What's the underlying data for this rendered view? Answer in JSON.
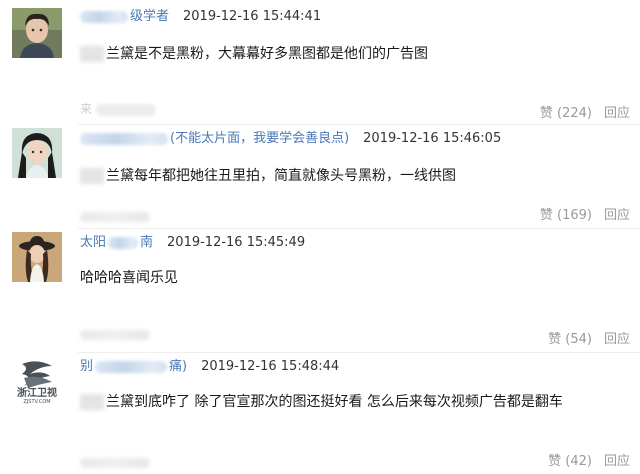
{
  "comments": [
    {
      "name": "级学者",
      "timestamp": "2019-12-16 15:44:41",
      "text": "兰黛是不是黑粉，大幕幕好多黑图都是他们的广告图",
      "sub_prefix": "来",
      "likes_label": "赞 (224)",
      "reply_label": "回应"
    },
    {
      "name": "(不能太片面，我要学会善良点)",
      "timestamp": "2019-12-16 15:46:05",
      "text": "兰黛每年都把她往丑里拍，简直就像头号黑粉，一线供图",
      "likes_label": "赞 (169)",
      "reply_label": "回应"
    },
    {
      "name": "太阳",
      "name_suffix": "南",
      "timestamp": "2019-12-16 15:45:49",
      "text": "哈哈哈喜闻乐见",
      "likes_label": "赞 (54)",
      "reply_label": "回应"
    },
    {
      "name": "别",
      "name_suffix": "痛)",
      "timestamp": "2019-12-16 15:48:44",
      "text": "兰黛到底咋了 除了官宣那次的图还挺好看 怎么后来每次视频广告都是翻车",
      "likes_label": "赞 (42)",
      "reply_label": "回应"
    }
  ],
  "logo_text": "浙江卫视",
  "logo_subtext": "ZJSTV.COM",
  "colors": {
    "name": "#4a78b7",
    "timestamp": "#333333",
    "muted": "#999999",
    "logo": "#4a5058"
  }
}
